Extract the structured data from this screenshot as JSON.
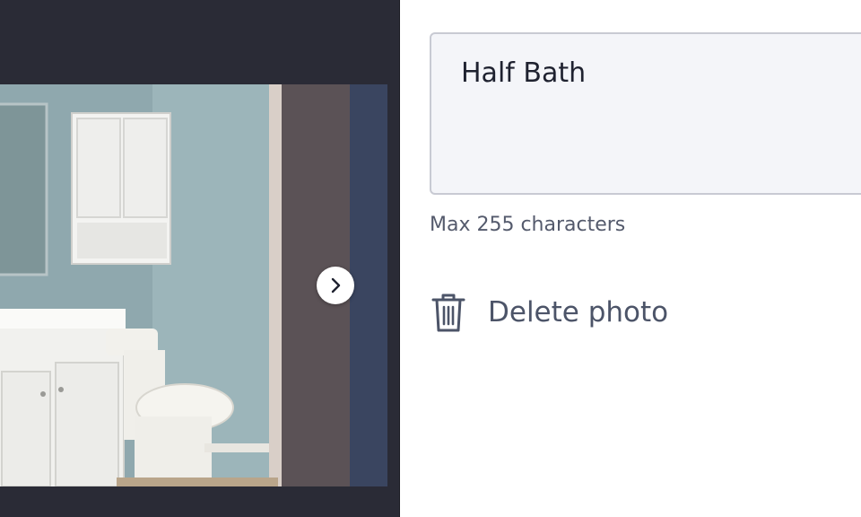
{
  "viewer": {
    "background": "#2a2b36",
    "next_icon": "chevron-right-icon",
    "photo_description_icon": "bathroom-photo"
  },
  "caption": {
    "value": "Half Bath",
    "hint": "Max 255 characters"
  },
  "actions": {
    "delete_label": "Delete photo",
    "delete_icon": "trash-icon"
  }
}
